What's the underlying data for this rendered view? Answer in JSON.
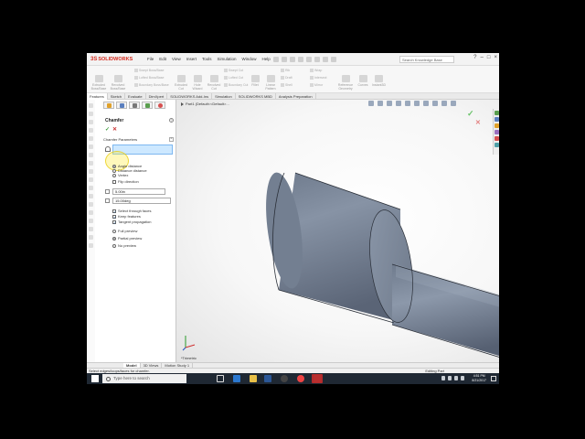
{
  "app": {
    "logo_ds": "3S",
    "logo_text": "SOLIDWORKS",
    "menus": [
      "File",
      "Edit",
      "View",
      "Insert",
      "Tools",
      "Simulation",
      "Window",
      "Help"
    ],
    "search_placeholder": "Search Knowledge Base",
    "window_buttons": [
      "?",
      "–",
      "□",
      "×"
    ]
  },
  "command_manager": {
    "large_buttons": [
      "Extruded Boss/Base",
      "Revolved Boss/Base",
      "Extruded Cut",
      "Hole Wizard",
      "Revolved Cut",
      "Fillet",
      "Linear Pattern",
      "Reference Geometry",
      "Curves",
      "Instant3D"
    ],
    "small_buttons": [
      "Swept Boss/Base",
      "Lofted Boss/Base",
      "Boundary Boss/Base",
      "Swept Cut",
      "Lofted Cut",
      "Boundary Cut",
      "Rib",
      "Draft",
      "Shell",
      "Wrap",
      "Intersect",
      "Mirror"
    ]
  },
  "tabs": [
    "Features",
    "Sketch",
    "Evaluate",
    "DimXpert",
    "SOLIDWORKS Add-Ins",
    "Simulation",
    "SOLIDWORKS MBD",
    "Analysis Preparation"
  ],
  "tabs_active": 0,
  "property_manager": {
    "title": "Chamfer",
    "help": "?",
    "ok": "✓",
    "cancel": "✕",
    "group_title": "Chamfer Parameters",
    "collapse": "^",
    "chamfer_types": [
      "Angle distance",
      "Distance distance",
      "Vertex"
    ],
    "chamfer_type_selected": 0,
    "flip_direction": "Flip direction",
    "distance_value": "5.00in",
    "angle_value": "15.00deg",
    "options": [
      {
        "label": "Select through faces",
        "checked": true
      },
      {
        "label": "Keep features",
        "checked": true
      },
      {
        "label": "Tangent propagation",
        "checked": true
      }
    ],
    "preview_modes": [
      "Full preview",
      "Partial preview",
      "No preview"
    ],
    "preview_selected": 1
  },
  "viewport": {
    "tree_label": "Part1 (Default<<Default>...",
    "view_label": "*Trimetric"
  },
  "bottom_tabs": [
    "Model",
    "3D Views",
    "Motion Study 1"
  ],
  "status": {
    "message": "Select edges/loops/faces for chamfer.",
    "right": "Editing Part"
  },
  "taskbar": {
    "search_placeholder": "Type here to search",
    "time": "4:51 PM",
    "date": "8/21/2017"
  },
  "colors": {
    "part_face": "#7d8a9c",
    "part_end_face": "#8e9bad",
    "highlight": "#fff23c",
    "ok_green": "#3a9a3a",
    "cancel_red": "#c83030",
    "brand_red": "#d52b1e"
  }
}
